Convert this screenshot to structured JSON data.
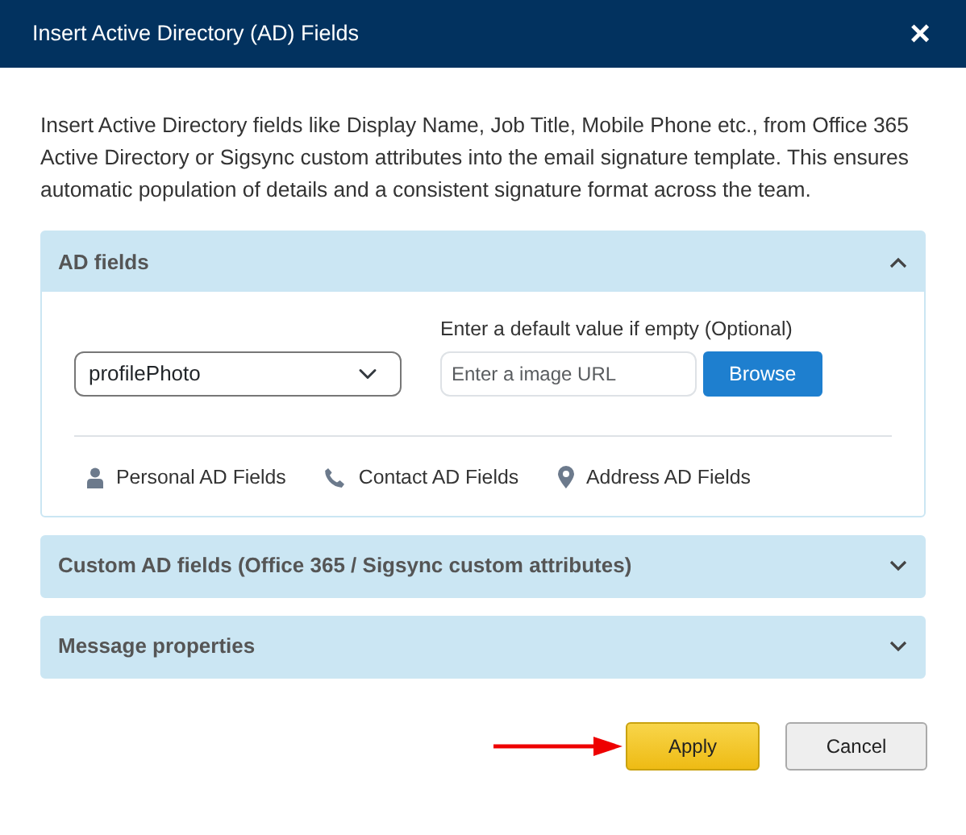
{
  "window": {
    "title": "Insert Active Directory (AD) Fields",
    "close": "×"
  },
  "description": "Insert Active Directory fields like Display Name, Job Title, Mobile Phone etc., from Office 365 Active Directory or Sigsync custom attributes into the email signature template. This ensures automatic population of details and a consistent signature format across the team.",
  "sections": [
    {
      "title": "AD fields",
      "expanded": true,
      "field_select": {
        "value": "profilePhoto"
      },
      "default_label": "Enter a default value if empty (Optional)",
      "default_input": {
        "placeholder": "Enter a image URL"
      },
      "browse_button": "Browse",
      "categories": [
        {
          "kind": "person",
          "label": "Personal AD Fields"
        },
        {
          "kind": "phone",
          "label": "Contact AD Fields"
        },
        {
          "kind": "pin",
          "label": "Address AD Fields"
        }
      ]
    },
    {
      "title": "Custom AD fields (Office 365 / Sigsync custom attributes)",
      "expanded": false
    },
    {
      "title": "Message properties",
      "expanded": false
    }
  ],
  "buttons": [
    {
      "kind": "primary",
      "label": "Apply",
      "arrow": true
    },
    {
      "kind": "secondary",
      "label": "Cancel",
      "arrow": false
    }
  ]
}
